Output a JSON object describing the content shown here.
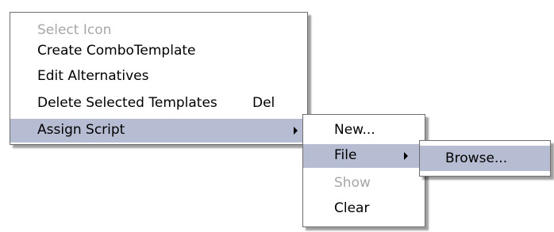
{
  "context_menu": {
    "items": [
      {
        "label": "Select Icon",
        "disabled": true
      },
      {
        "label": "Create ComboTemplate"
      },
      {
        "label": "Edit Alternatives"
      },
      {
        "label": "Delete Selected Templates",
        "shortcut": "Del"
      },
      {
        "label": "Assign Script",
        "has_submenu": true,
        "highlighted": true
      }
    ]
  },
  "assign_script_submenu": {
    "items": [
      {
        "label": "New..."
      },
      {
        "label": "File",
        "has_submenu": true,
        "highlighted": true
      },
      {
        "label": "Show",
        "disabled": true
      },
      {
        "label": "Clear"
      }
    ]
  },
  "file_submenu": {
    "items": [
      {
        "label": "Browse...",
        "highlighted": true
      }
    ]
  },
  "colors": {
    "highlight": "#b6bdd2",
    "disabled_text": "#a7a6aa",
    "border": "#6e6e6e"
  }
}
